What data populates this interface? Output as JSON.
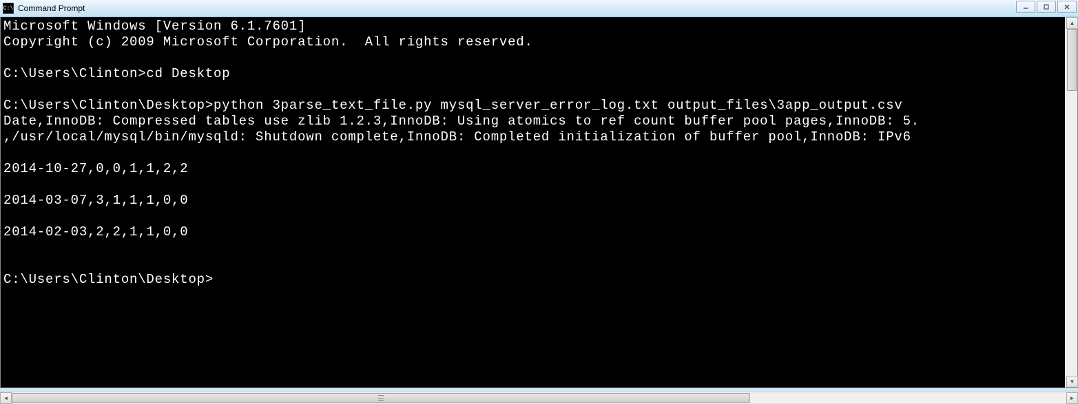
{
  "window": {
    "title": "Command Prompt",
    "icon_text": "C:\\"
  },
  "terminal": {
    "lines": [
      "Microsoft Windows [Version 6.1.7601]",
      "Copyright (c) 2009 Microsoft Corporation.  All rights reserved.",
      "",
      "C:\\Users\\Clinton>cd Desktop",
      "",
      "C:\\Users\\Clinton\\Desktop>python 3parse_text_file.py mysql_server_error_log.txt output_files\\3app_output.csv",
      "Date,InnoDB: Compressed tables use zlib 1.2.3,InnoDB: Using atomics to ref count buffer pool pages,InnoDB: 5.",
      ",/usr/local/mysql/bin/mysqld: Shutdown complete,InnoDB: Completed initialization of buffer pool,InnoDB: IPv6",
      "",
      "2014-10-27,0,0,1,1,2,2",
      "",
      "2014-03-07,3,1,1,1,0,0",
      "",
      "2014-02-03,2,2,1,1,0,0",
      "",
      "",
      "C:\\Users\\Clinton\\Desktop>"
    ]
  }
}
